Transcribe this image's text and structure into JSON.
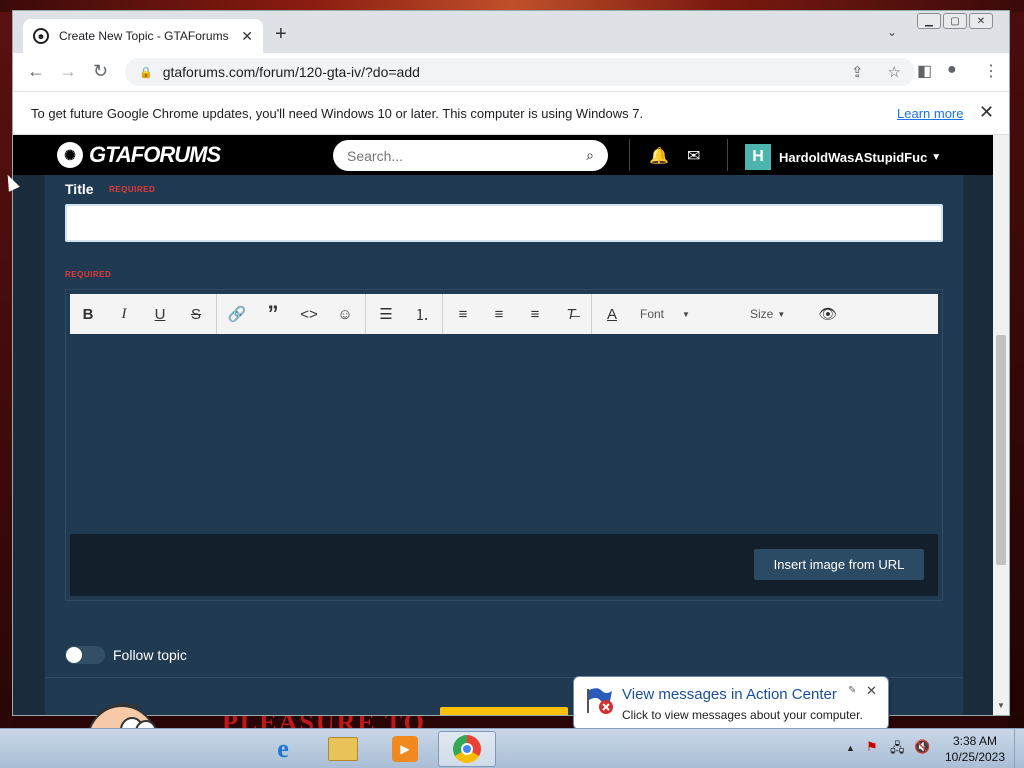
{
  "browser": {
    "tab": {
      "title": "Create New Topic - GTAForums"
    },
    "url": "gtaforums.com/forum/120-gta-iv/?do=add",
    "infobar": {
      "message": "To get future Google Chrome updates, you'll need Windows 10 or later. This computer is using Windows 7.",
      "link": "Learn more"
    }
  },
  "site": {
    "logo": "GTAFORUMS",
    "search_placeholder": "Search...",
    "user": {
      "initial": "H",
      "name": "HardoldWasAStupidFuc"
    }
  },
  "form": {
    "title_label": "Title",
    "required_label": "REQUIRED",
    "toolbar": {
      "bold": "B",
      "italic": "I",
      "underline": "U",
      "strike": "S",
      "font_label": "Font",
      "size_label": "Size"
    },
    "insert_image_button": "Insert image from URL",
    "follow_topic_label": "Follow topic",
    "follow_topic_on": false
  },
  "background": {
    "red_text": "PLEASURE TO"
  },
  "notification": {
    "title": "View messages in Action Center",
    "subtitle": "Click to view messages about your computer."
  },
  "taskbar": {
    "time": "3:38 AM",
    "date": "10/25/2023"
  }
}
